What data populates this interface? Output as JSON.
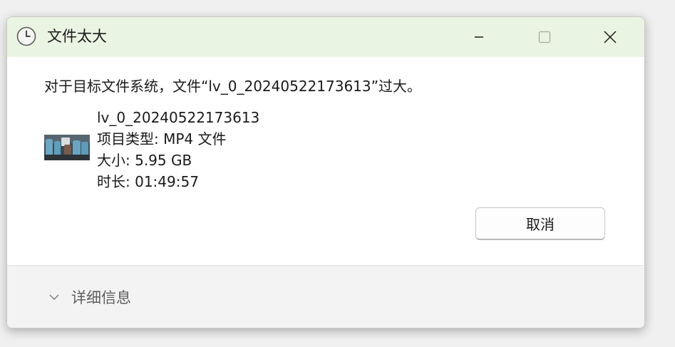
{
  "window": {
    "title": "文件太大",
    "title_icon": "clock-icon",
    "controls": {
      "minimize_icon": "minimize-icon",
      "maximize_icon": "maximize-icon",
      "close_icon": "close-icon"
    }
  },
  "message": "对于目标文件系统，文件“lv_0_20240522173613”过大。",
  "file": {
    "thumbnail_icon": "video-thumbnail",
    "name": "lv_0_20240522173613",
    "type_line": "项目类型: MP4 文件",
    "size_line": "大小: 5.95 GB",
    "duration_line": "时长: 01:49:57"
  },
  "buttons": {
    "cancel_label": "取消"
  },
  "footer": {
    "details_label": "详细信息",
    "details_icon": "chevron-down-icon"
  },
  "colors": {
    "titlebar_bg": "#eaf4e2",
    "footer_bg": "#f3f3f3",
    "text": "#1a1a1a",
    "muted_text": "#5f5f5f"
  }
}
